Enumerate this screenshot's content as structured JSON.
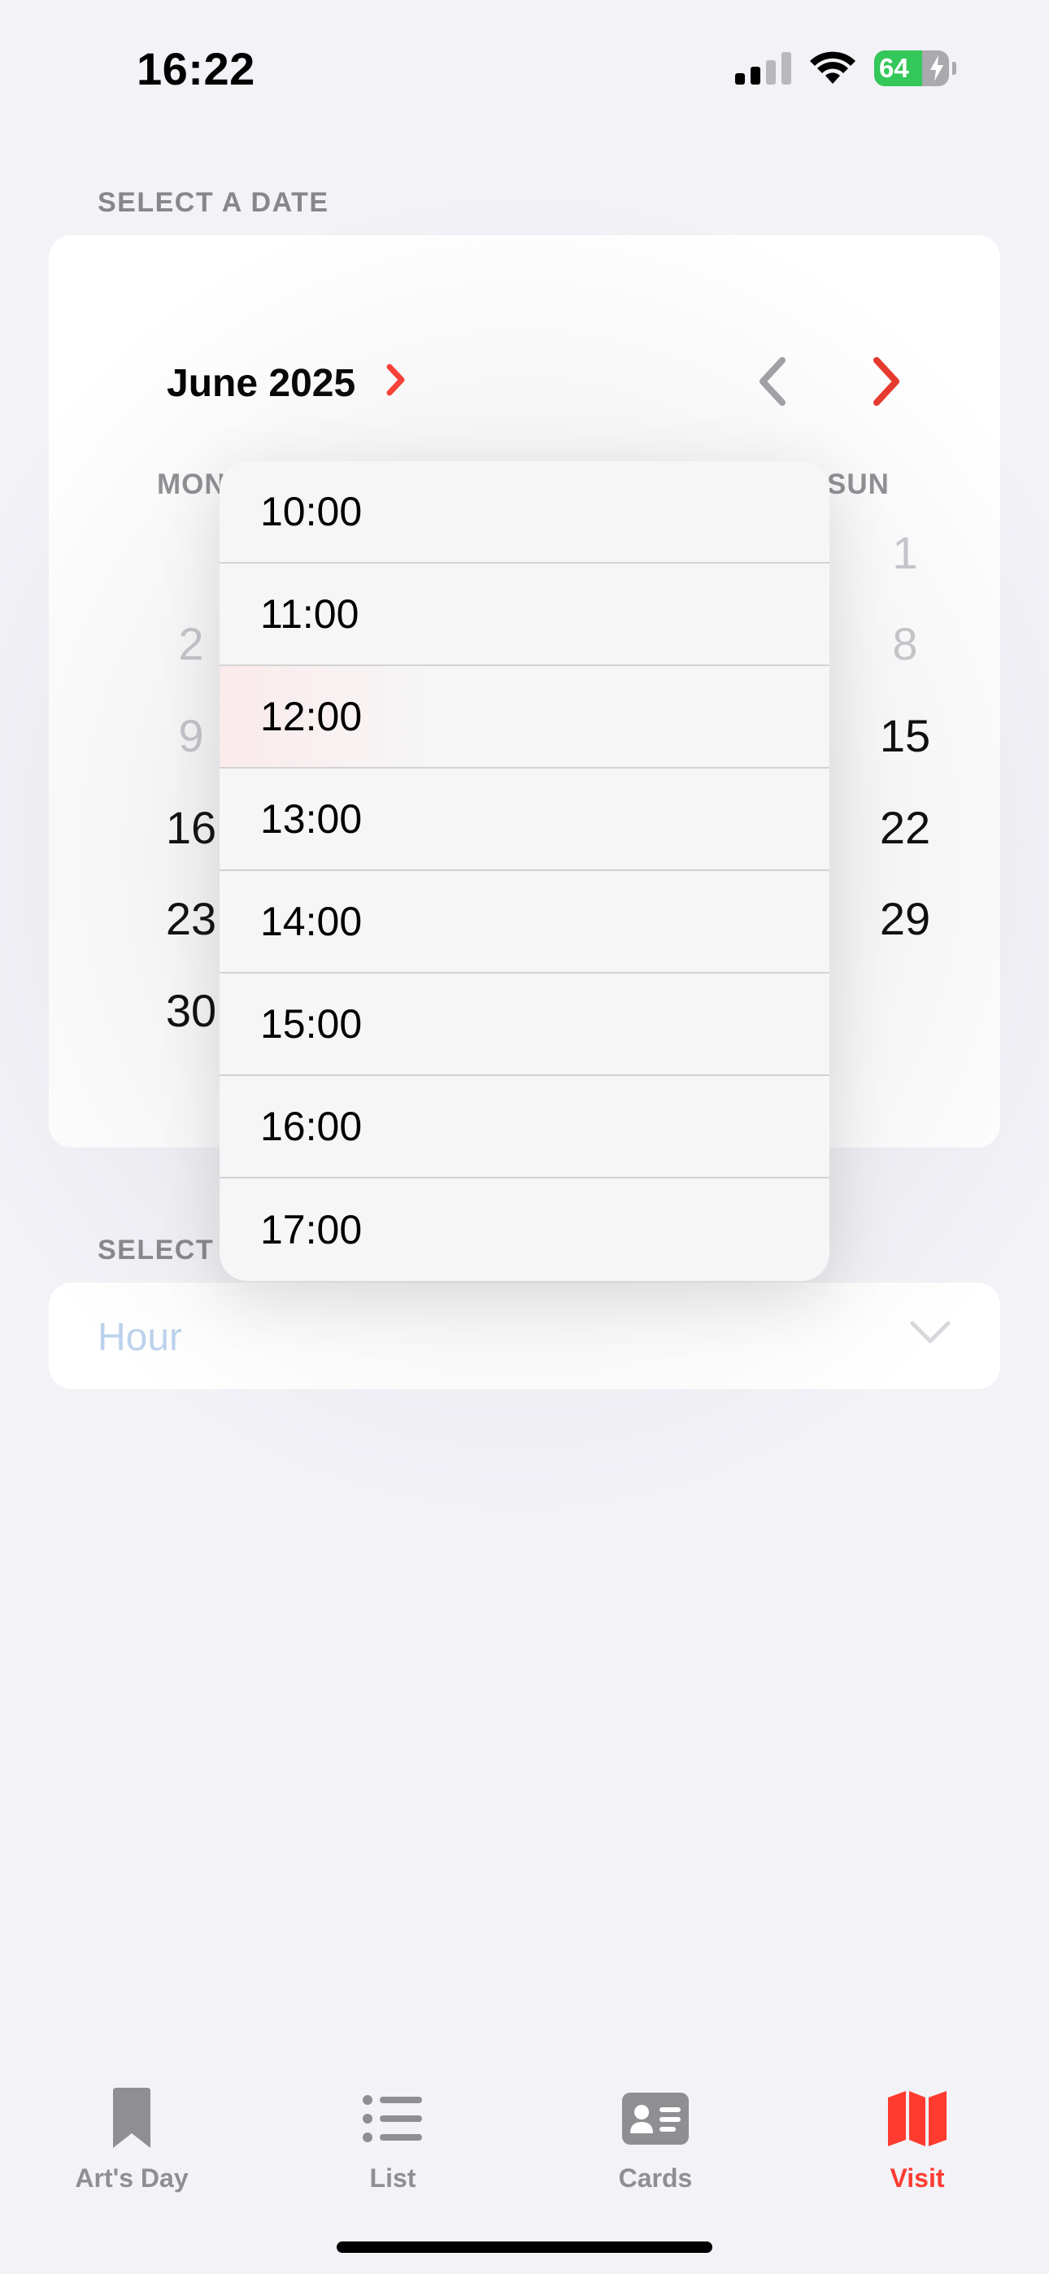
{
  "status_bar": {
    "time": "16:22",
    "battery_percent": "64"
  },
  "date_section": {
    "label": "SELECT A DATE",
    "month": "June 2025",
    "weekdays": {
      "mon": "MON",
      "sun": "SUN"
    },
    "days": {
      "d1": "1",
      "d2": "2",
      "d8": "8",
      "d9": "9",
      "d15": "15",
      "d16": "16",
      "d22": "22",
      "d23": "23",
      "d29": "29",
      "d30": "30"
    }
  },
  "hour_section": {
    "label": "SELECT A",
    "placeholder": "Hour"
  },
  "dropdown": {
    "options": [
      "10:00",
      "11:00",
      "12:00",
      "13:00",
      "14:00",
      "15:00",
      "16:00",
      "17:00"
    ]
  },
  "tabs": [
    {
      "label": "Art's Day",
      "icon": "bookmark-icon"
    },
    {
      "label": "List",
      "icon": "list-icon"
    },
    {
      "label": "Cards",
      "icon": "id-card-icon"
    },
    {
      "label": "Visit",
      "icon": "map-icon",
      "active": true
    }
  ],
  "colors": {
    "accent": "#ff3b30",
    "inactive": "#8e8e93",
    "battery_green": "#34c759"
  }
}
